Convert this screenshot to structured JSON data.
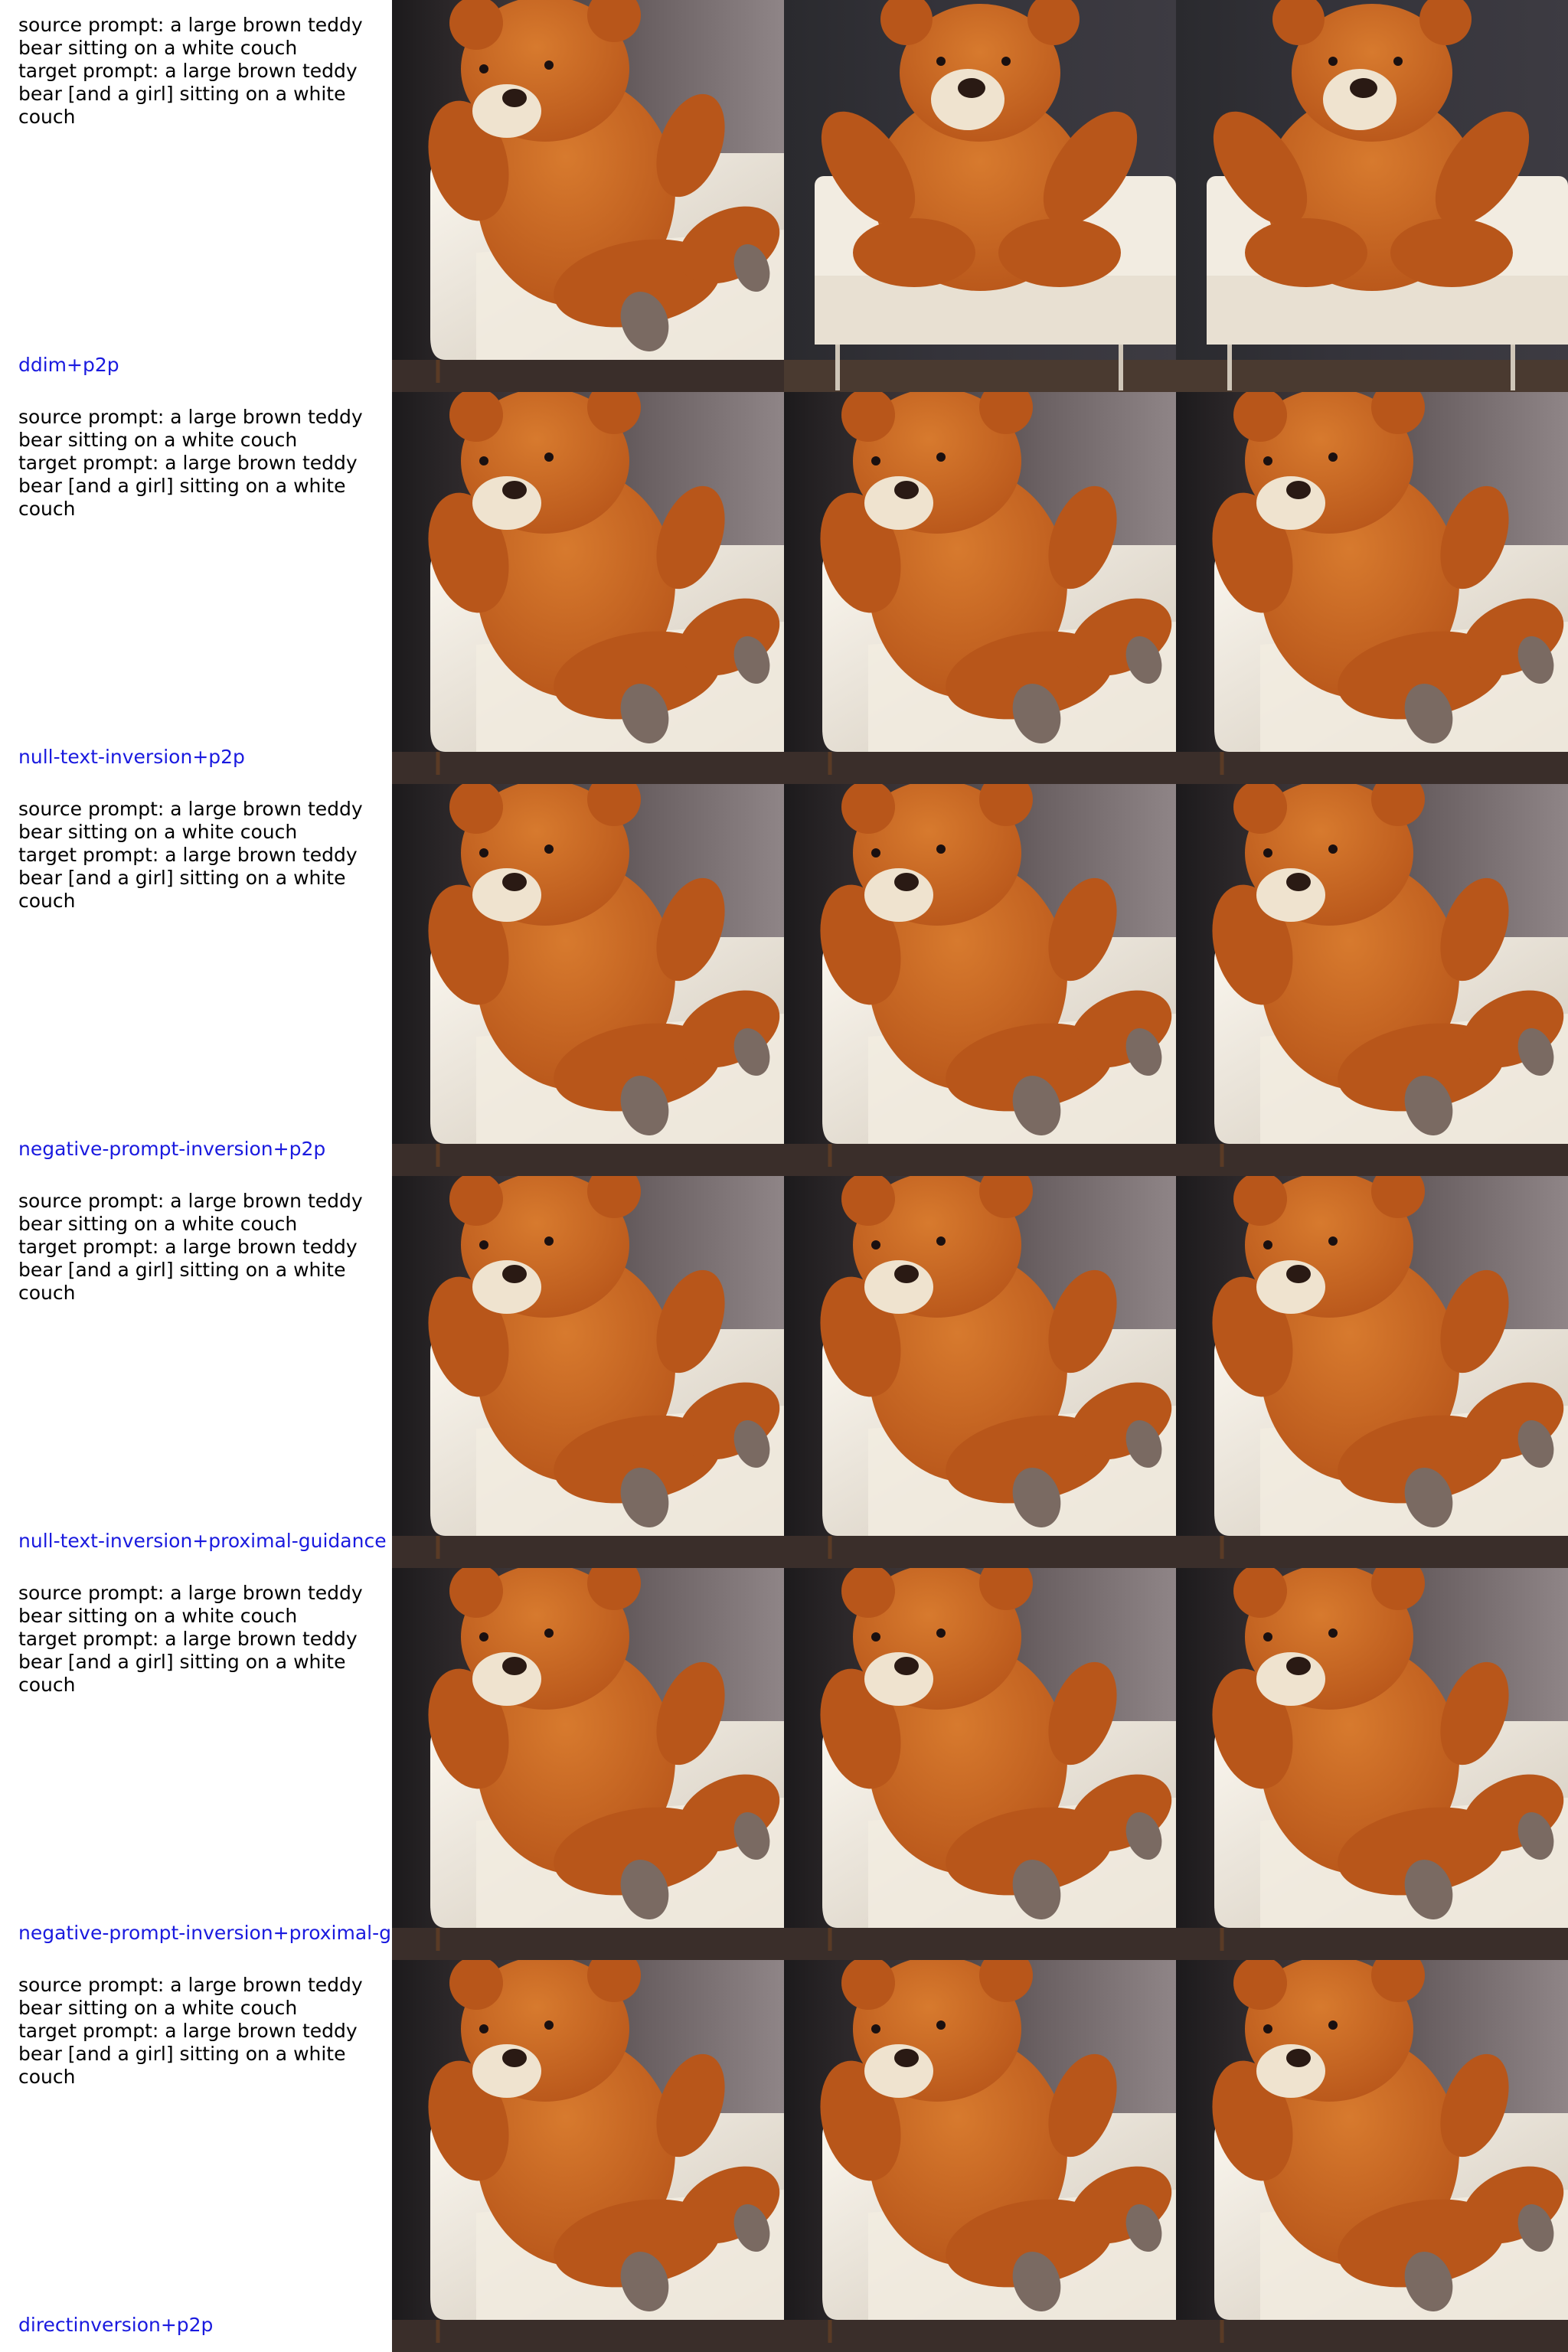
{
  "rows": [
    {
      "prompt_text": "source prompt: a large brown teddy\nbear sitting on a white couch\ntarget prompt: a large brown teddy\nbear [and a girl] sitting on a white\ncouch",
      "method": "ddim+p2p",
      "images": [
        "teddy-bear-on-couch-image",
        "teddy-bear-on-couch-image",
        "teddy-bear-on-couch-image"
      ]
    },
    {
      "prompt_text": "source prompt: a large brown teddy\nbear sitting on a white couch\ntarget prompt: a large brown teddy\nbear [and a girl] sitting on a white\ncouch",
      "method": "null-text-inversion+p2p",
      "images": [
        "teddy-bear-on-couch-image",
        "teddy-bear-on-couch-image",
        "teddy-bear-on-couch-image"
      ]
    },
    {
      "prompt_text": "source prompt: a large brown teddy\nbear sitting on a white couch\ntarget prompt: a large brown teddy\nbear [and a girl] sitting on a white\ncouch",
      "method": "negative-prompt-inversion+p2p",
      "images": [
        "teddy-bear-on-couch-image",
        "teddy-bear-on-couch-image",
        "teddy-bear-on-couch-image"
      ]
    },
    {
      "prompt_text": "source prompt: a large brown teddy\nbear sitting on a white couch\ntarget prompt: a large brown teddy\nbear [and a girl] sitting on a white\ncouch",
      "method": "null-text-inversion+proximal-guidance",
      "images": [
        "teddy-bear-on-couch-image",
        "teddy-bear-on-couch-image",
        "teddy-bear-on-couch-image"
      ]
    },
    {
      "prompt_text": "source prompt: a large brown teddy\nbear sitting on a white couch\ntarget prompt: a large brown teddy\nbear [and a girl] sitting on a white\ncouch",
      "method": "negative-prompt-inversion+proximal-g",
      "images": [
        "teddy-bear-on-couch-image",
        "teddy-bear-on-couch-image",
        "teddy-bear-on-couch-image"
      ]
    },
    {
      "prompt_text": "source prompt: a large brown teddy\nbear sitting on a white couch\ntarget prompt: a large brown teddy\nbear [and a girl] sitting on a white\ncouch",
      "method": "directinversion+p2p",
      "images": [
        "teddy-bear-on-couch-image",
        "teddy-bear-on-couch-image",
        "teddy-bear-on-couch-image"
      ]
    }
  ],
  "colors": {
    "label_text": "#000000",
    "method_text": "#1a1adf",
    "bear_fur": "#b8561a",
    "couch": "#f2ece1"
  }
}
